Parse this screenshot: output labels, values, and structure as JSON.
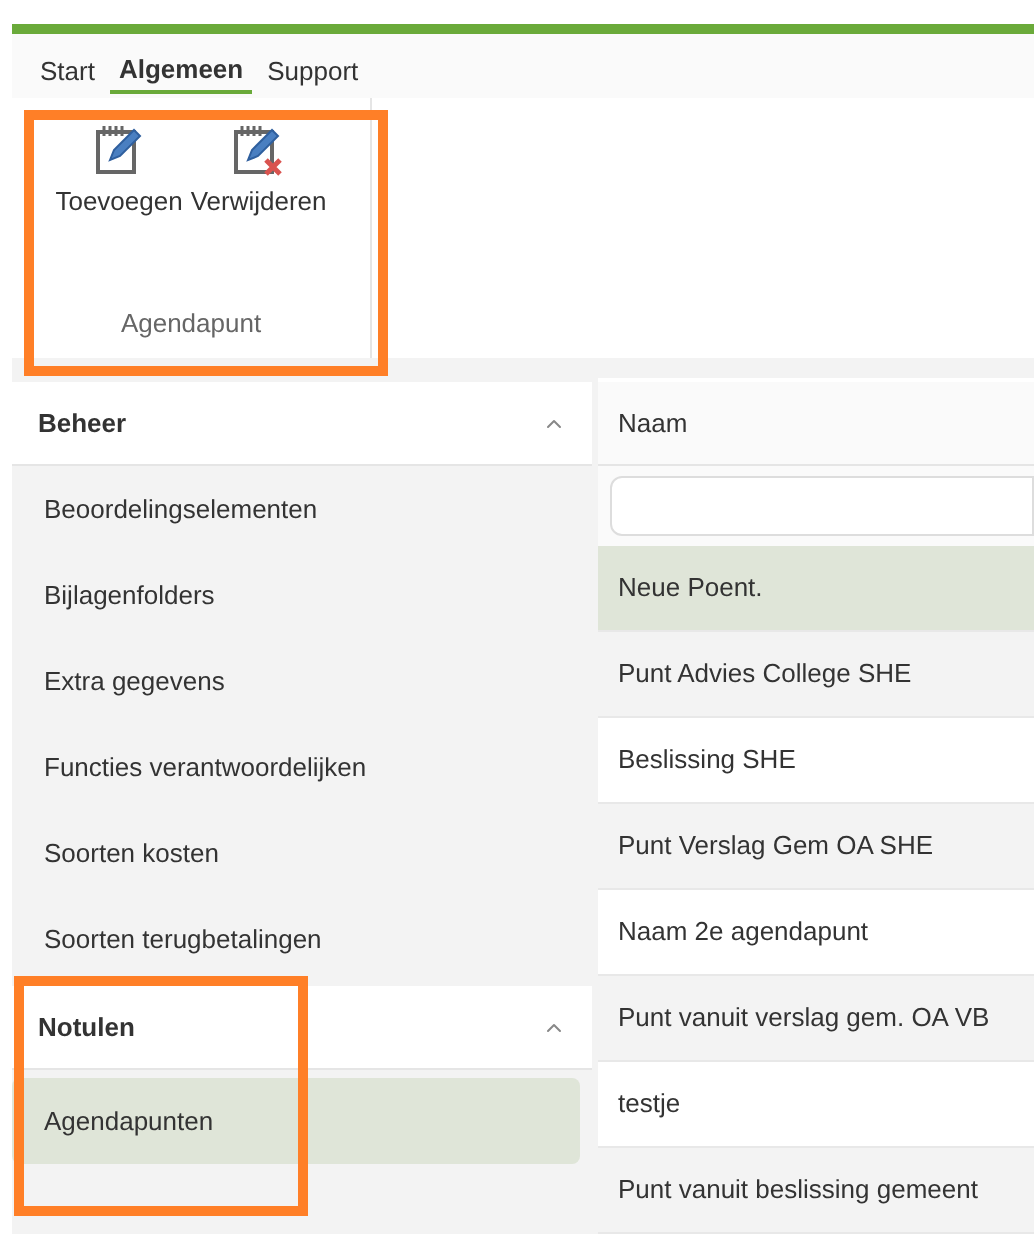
{
  "tabs": [
    {
      "label": "Start",
      "selected": false
    },
    {
      "label": "Algemeen",
      "selected": true
    },
    {
      "label": "Support",
      "selected": false
    }
  ],
  "ribbon": {
    "group_label": "Agendapunt",
    "buttons": [
      {
        "kind": "add",
        "label": "Toevoegen"
      },
      {
        "kind": "delete",
        "label": "Verwijderen"
      }
    ]
  },
  "sidebar": {
    "sections": [
      {
        "title": "Beheer",
        "expanded": true,
        "items": [
          {
            "label": "Beoordelingselementen",
            "selected": false
          },
          {
            "label": "Bijlagenfolders",
            "selected": false
          },
          {
            "label": "Extra gegevens",
            "selected": false
          },
          {
            "label": "Functies verantwoordelijken",
            "selected": false
          },
          {
            "label": "Soorten kosten",
            "selected": false
          },
          {
            "label": "Soorten terugbetalingen",
            "selected": false
          }
        ]
      },
      {
        "title": "Notulen",
        "expanded": true,
        "items": [
          {
            "label": "Agendapunten",
            "selected": true
          }
        ]
      }
    ]
  },
  "table": {
    "columns": [
      "Naam"
    ],
    "rows": [
      {
        "name": "Neue Poent.",
        "selected": true
      },
      {
        "name": "Punt Advies College SHE",
        "selected": false
      },
      {
        "name": "Beslissing SHE",
        "selected": false
      },
      {
        "name": "Punt Verslag Gem OA SHE",
        "selected": false
      },
      {
        "name": "Naam 2e agendapunt",
        "selected": false
      },
      {
        "name": "Punt vanuit verslag gem. OA VB",
        "selected": false
      },
      {
        "name": "testje",
        "selected": false
      },
      {
        "name": "Punt vanuit beslissing gemeent",
        "selected": false
      }
    ]
  }
}
